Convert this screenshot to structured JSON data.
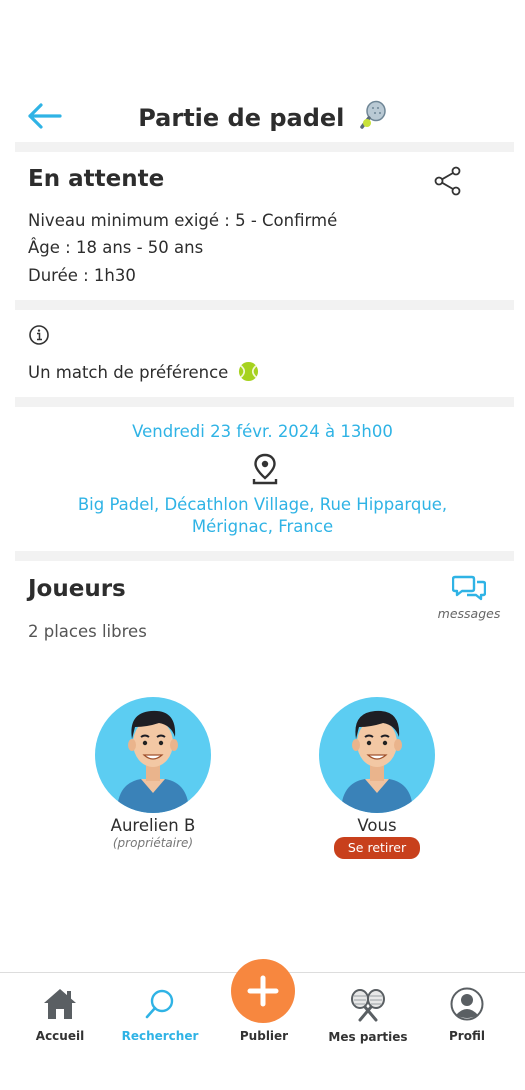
{
  "header": {
    "title": "Partie de padel"
  },
  "status": {
    "title": "En attente",
    "level": "Niveau minimum exigé : 5 - Confirmé",
    "age": "Âge : 18 ans - 50 ans",
    "duration": "Durée : 1h30"
  },
  "preference": {
    "text": "Un match de préférence"
  },
  "event": {
    "date": "Vendredi 23 févr. 2024 à 13h00",
    "address_line1": "Big Padel, Décathlon Village, Rue Hipparque,",
    "address_line2": "Mérignac, France"
  },
  "players": {
    "title": "Joueurs",
    "places": "2 places libres",
    "messages_label": "messages",
    "list": [
      {
        "name": "Aurelien B",
        "role": "(propriétaire)"
      },
      {
        "name": "Vous",
        "action": "Se retirer"
      }
    ]
  },
  "tabbar": {
    "items": [
      {
        "label": "Accueil",
        "icon": "home-icon"
      },
      {
        "label": "Rechercher",
        "icon": "search-icon"
      },
      {
        "label": "Publier",
        "icon": "plus-icon"
      },
      {
        "label": "Mes parties",
        "icon": "rackets-icon"
      },
      {
        "label": "Profil",
        "icon": "user-icon"
      }
    ],
    "active": "Rechercher"
  },
  "colors": {
    "accent": "#2fb3e5",
    "fab": "#f7873f",
    "danger": "#c8401c",
    "avatar_bg": "#5ccdf2"
  }
}
